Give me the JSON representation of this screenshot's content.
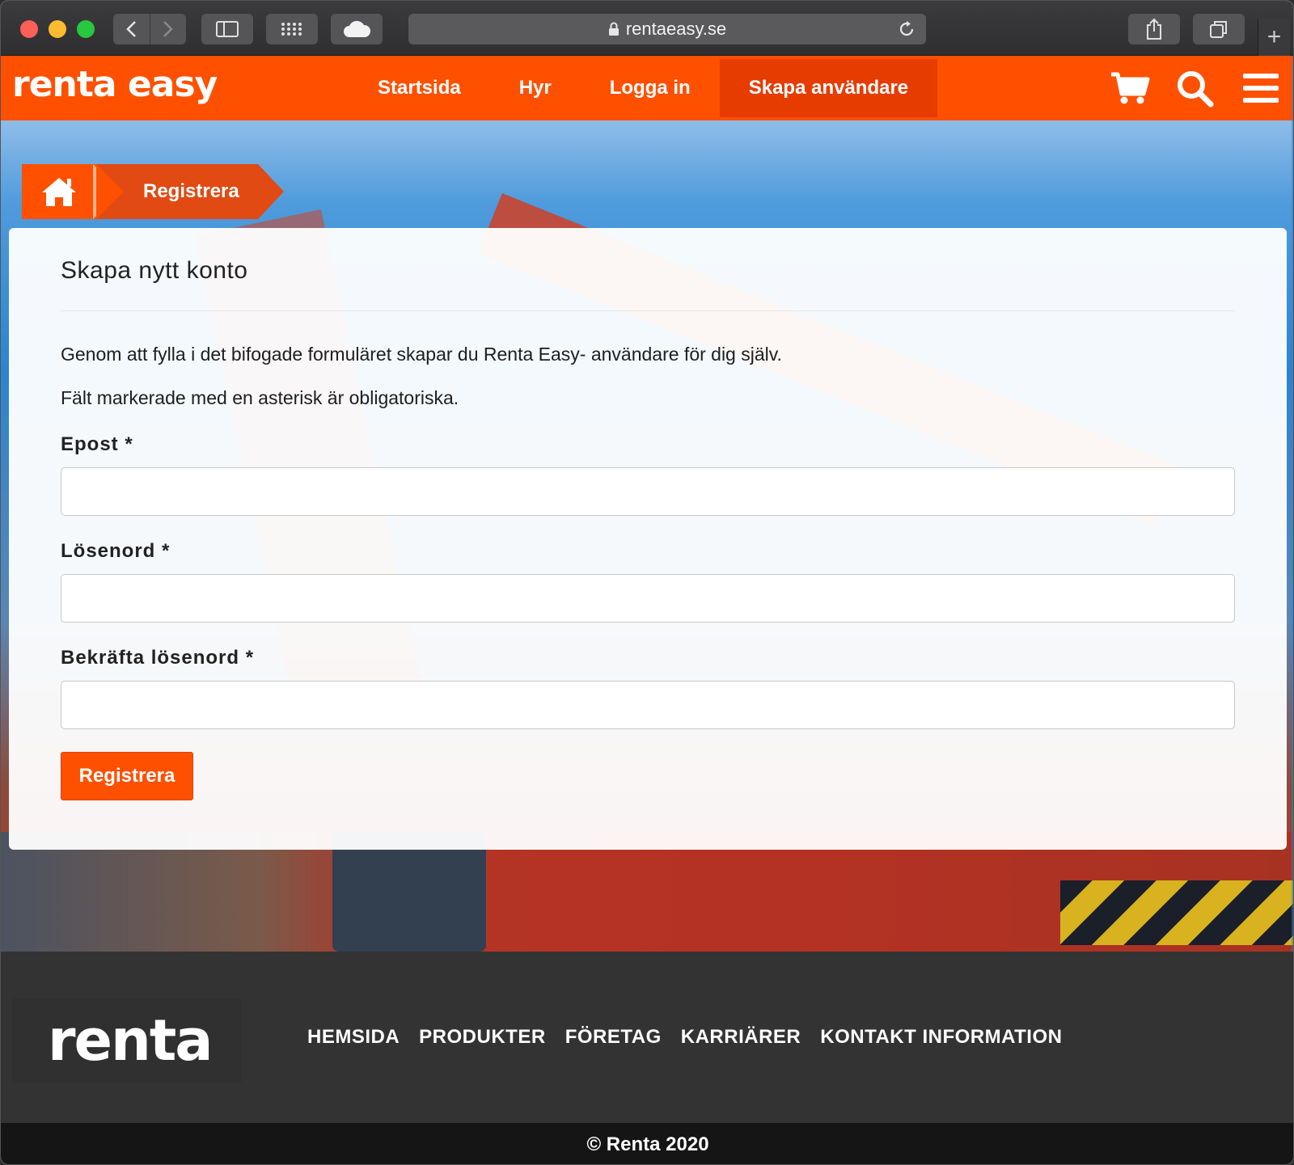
{
  "browser": {
    "url": "rentaeasy.se",
    "new_tab_symbol": "+"
  },
  "header": {
    "logo_text": "renta easy",
    "nav": [
      {
        "label": "Startsida"
      },
      {
        "label": "Hyr"
      },
      {
        "label": "Logga in"
      },
      {
        "label": "Skapa användare",
        "active": true
      }
    ],
    "icons": [
      "cart-icon",
      "search-icon",
      "menu-icon"
    ],
    "brand_color": "#ff5000"
  },
  "breadcrumb": {
    "current": "Registrera"
  },
  "form": {
    "title": "Skapa nytt konto",
    "intro": "Genom att fylla i det bifogade formuläret skapar du Renta Easy- användare för dig själv.",
    "required_note": "Fält markerade med en asterisk är obligatoriska.",
    "fields": [
      {
        "label": "Epost *",
        "value": ""
      },
      {
        "label": "Lösenord *",
        "value": ""
      },
      {
        "label": "Bekräfta lösenord *",
        "value": ""
      }
    ],
    "submit_label": "Registrera"
  },
  "footer": {
    "logo_text": "renta",
    "nav": [
      {
        "label": "HEMSIDA"
      },
      {
        "label": "PRODUKTER"
      },
      {
        "label": "FÖRETAG"
      },
      {
        "label": "KARRIÄRER"
      },
      {
        "label": "KONTAKT INFORMATION"
      }
    ],
    "copyright": "© Renta 2020"
  }
}
